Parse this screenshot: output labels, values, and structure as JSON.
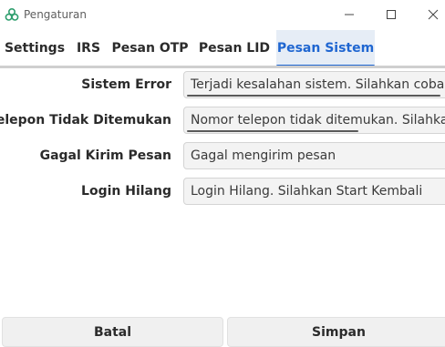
{
  "window": {
    "title": "Pengaturan",
    "icon": "app-logo-icon",
    "accent": "#1f66d1"
  },
  "tabs": [
    {
      "label": "Settings",
      "active": false
    },
    {
      "label": "IRS",
      "active": false
    },
    {
      "label": "Pesan OTP",
      "active": false
    },
    {
      "label": "Pesan LID",
      "active": false
    },
    {
      "label": "Pesan Sistem",
      "active": true
    }
  ],
  "form": {
    "rows": [
      {
        "label": "Sistem Error",
        "value": "Terjadi kesalahan sistem. Silahkan coba lagi"
      },
      {
        "label": "Telepon Tidak Ditemukan",
        "value": "Nomor telepon tidak ditemukan. Silahkan l"
      },
      {
        "label": "Gagal Kirim Pesan",
        "value": "Gagal mengirim pesan"
      },
      {
        "label": "Login Hilang",
        "value": "Login Hilang. Silahkan Start Kembali"
      }
    ]
  },
  "footer": {
    "cancel_label": "Batal",
    "save_label": "Simpan"
  }
}
